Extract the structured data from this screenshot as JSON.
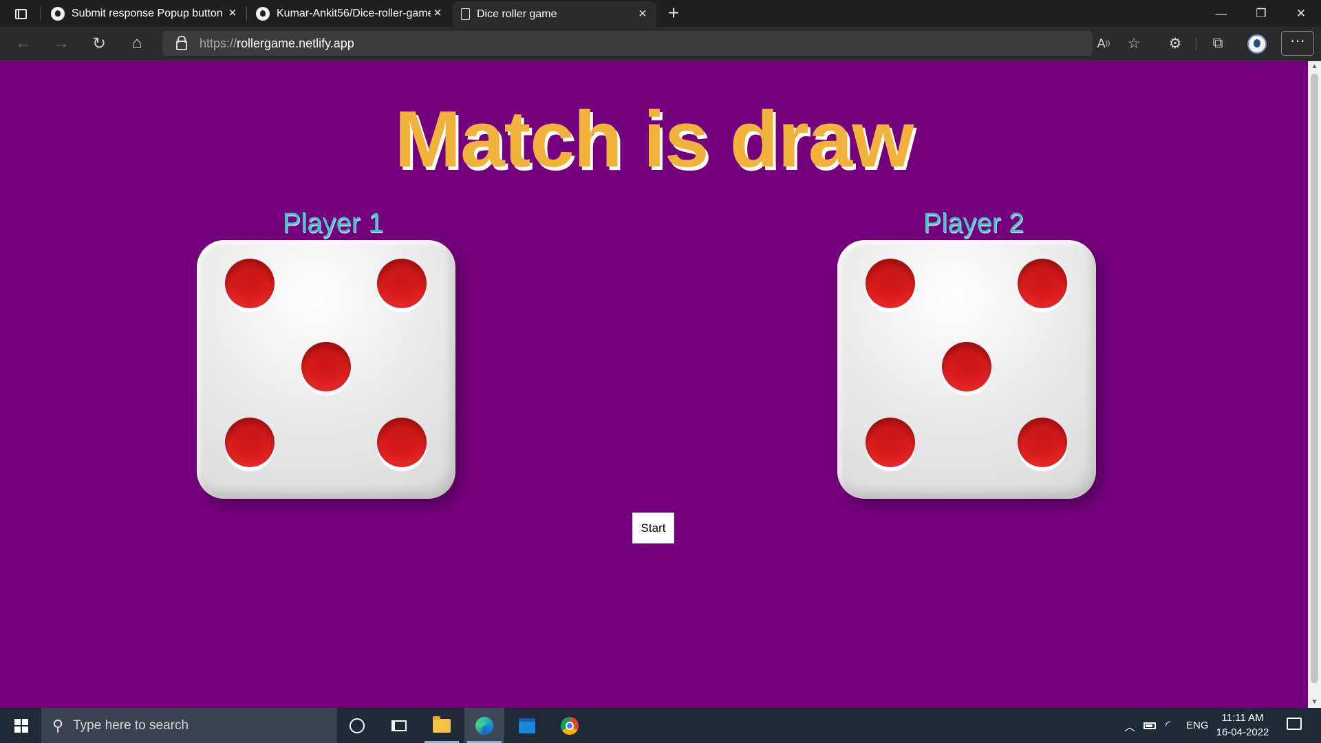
{
  "browser": {
    "tabs": [
      {
        "title": "Submit response Popup button ·",
        "icon": "github-icon",
        "active": false
      },
      {
        "title": "Kumar-Ankit56/Dice-roller-game",
        "icon": "github-icon",
        "active": false
      },
      {
        "title": "Dice roller game",
        "icon": "document-icon",
        "active": true
      }
    ],
    "new_tab_glyph": "+",
    "url_protocol": "https://",
    "url_host": "rollergame.netlify.app"
  },
  "page": {
    "background": "#75007d",
    "headline": "Match is draw",
    "headline_color": "#f2b33d",
    "players": [
      {
        "label": "Player 1",
        "die_value": 5
      },
      {
        "label": "Player 2",
        "die_value": 5
      }
    ],
    "pip_color": "#d61a1a",
    "start_button": "Start"
  },
  "taskbar": {
    "search_placeholder": "Type here to search",
    "apps": [
      "cortana-icon",
      "task-view-icon",
      "file-explorer-icon",
      "edge-icon",
      "calendar-icon",
      "chrome-icon"
    ],
    "language": "ENG",
    "time": "11:11 AM",
    "date": "16-04-2022"
  }
}
